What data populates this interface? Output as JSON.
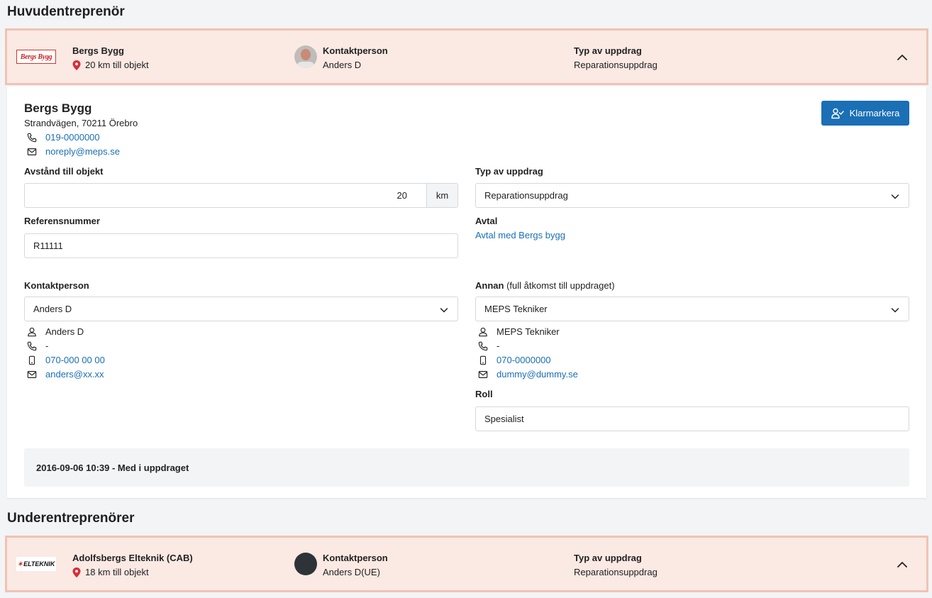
{
  "main_section": {
    "title": "Huvudentreprenör"
  },
  "main_contractor": {
    "logo_text": "Bergs Bygg",
    "name": "Bergs Bygg",
    "distance": "20 km till objekt",
    "contact_label": "Kontaktperson",
    "contact_name": "Anders D",
    "type_label": "Typ av uppdrag",
    "type_value": "Reparationsuppdrag"
  },
  "details": {
    "company_name": "Bergs Bygg",
    "address": "Strandvägen, 70211 Örebro",
    "phone": "019-0000000",
    "email": "noreply@meps.se",
    "complete_button": "Klarmarkera",
    "distance_label": "Avstånd till objekt",
    "distance_value": "20",
    "distance_unit": "km",
    "type_label": "Typ av uppdrag",
    "type_value": "Reparationsuppdrag",
    "reference_label": "Referensnummer",
    "reference_value": "R11111",
    "agreement_label": "Avtal",
    "agreement_link": "Avtal med Bergs bygg",
    "contact_label": "Kontaktperson",
    "contact_select": "Anders D",
    "contact": {
      "name": "Anders D",
      "phone": "-",
      "mobile": "070-000 00 00",
      "email": "anders@xx.xx"
    },
    "other_label": "Annan",
    "other_sub": "(full åtkomst till uppdraget)",
    "other_select": "MEPS Tekniker",
    "other": {
      "name": "MEPS Tekniker",
      "phone": "-",
      "mobile": "070-0000000",
      "email": "dummy@dummy.se"
    },
    "role_label": "Roll",
    "role_value": "Spesialist",
    "log_entry": "2016-09-06 10:39 - Med i uppdraget"
  },
  "sub_section": {
    "title": "Underentreprenörer"
  },
  "sub_contractor": {
    "logo_text": "ELTEKNIK",
    "name": "Adolfsbergs Elteknik (CAB)",
    "distance": "18 km till objekt",
    "contact_label": "Kontaktperson",
    "contact_name": "Anders D(UE)",
    "type_label": "Typ av uppdrag",
    "type_value": "Reparationsuppdrag"
  },
  "colors": {
    "accent": "#1a6fb5",
    "header_bg": "#fbe9e4",
    "header_border": "#f0c3b4",
    "pin": "#d32f3a"
  }
}
